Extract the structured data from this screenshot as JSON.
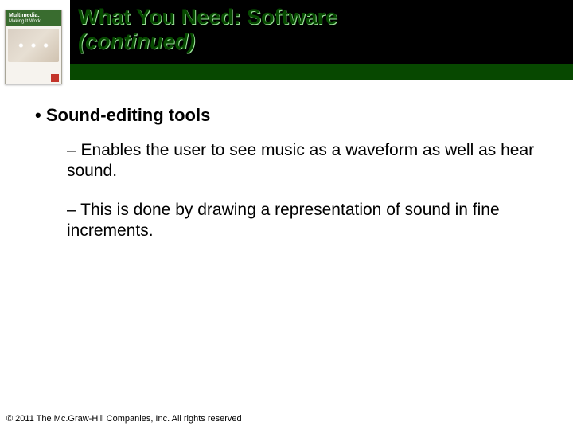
{
  "thumbnail": {
    "line1": "Multimedia:",
    "line2": "Making It Work"
  },
  "title": {
    "line1": "What You Need: Software",
    "line2": "(continued)"
  },
  "content": {
    "heading": "Sound-editing tools",
    "subs": [
      "Enables the user to see music as a waveform as well as hear sound.",
      "This is done by drawing a representation of sound in fine increments."
    ]
  },
  "footer": "© 2011 The Mc.Graw-Hill Companies, Inc. All rights reserved"
}
